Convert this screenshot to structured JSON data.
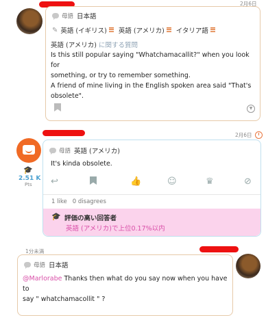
{
  "question": {
    "date": "2月6日",
    "native_label": "母語",
    "native_lang": "日本語",
    "learning": [
      {
        "lang": "英語 (イギリス)"
      },
      {
        "lang": "英語 (アメリカ)"
      },
      {
        "lang": "イタリア語"
      }
    ],
    "heading_lang": "英語 (アメリカ)",
    "heading_rest": "に関する質問",
    "body_line1": "Is this still popular saying \"Whatchamacallit?\" when you look for",
    "body_line2": "something, or try to remember something.",
    "body_line3": "A friend of mine living in the English spoken area said \"That's",
    "body_line4": "obsolete\".",
    "bookmark_icon": "bookmark-icon",
    "expand_icon": "chevron-down-circle-icon"
  },
  "answer": {
    "date": "2月6日",
    "native_label": "母語",
    "native_lang": "英語 (アメリカ)",
    "text": "It's kinda obsolete.",
    "points": "2.51 K",
    "points_label": "Pts",
    "likes": "1 like",
    "disagrees": "0 disagrees",
    "top_answer_title": "評価の高い回答者",
    "top_answer_sub": "英語 (アメリカ)で上位0.17%以内",
    "actions": [
      "reply-icon",
      "bookmark-icon",
      "thumbs-up-icon",
      "emoji-icon",
      "crown-icon",
      "block-icon"
    ]
  },
  "reply": {
    "date": "1分未満",
    "native_label": "母語",
    "native_lang": "日本語",
    "mention": "@Marlorabe",
    "text_line1": " Thanks then what do you say now when you have to",
    "text_line2": "say \" whatchamacollit \" ?"
  },
  "colors": {
    "accent_orange": "#f06a25",
    "pink": "#d94fa8",
    "pink_bg": "#fbd3ec",
    "card_border": "#e6c9a8"
  }
}
